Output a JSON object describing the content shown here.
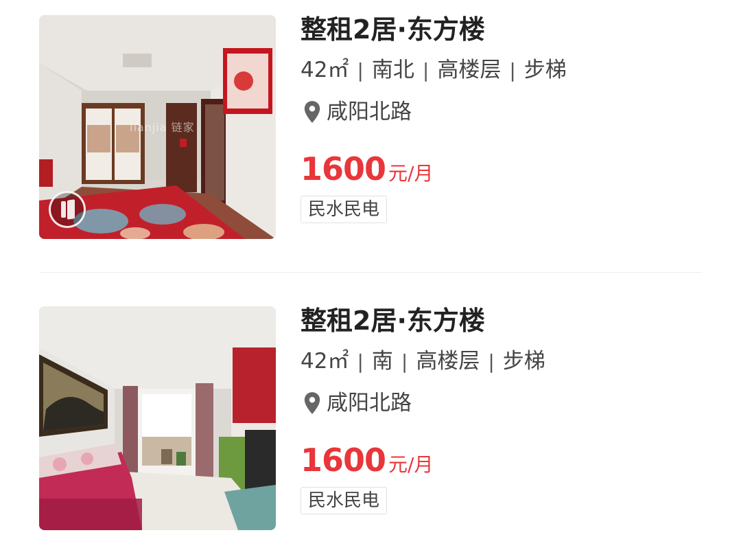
{
  "listings": [
    {
      "title": "整租2居·东方楼",
      "area": "42㎡",
      "orientation": "南北",
      "floor": "高楼层",
      "elevator": "步梯",
      "location": "咸阳北路",
      "price": "1600",
      "price_unit": "元/月",
      "tag": "民水民电",
      "thumb_watermark": "lianjia 链家",
      "has_vr_badge": true,
      "icon": "map-pin-icon"
    },
    {
      "title": "整租2居·东方楼",
      "area": "42㎡",
      "orientation": "南",
      "floor": "高楼层",
      "elevator": "步梯",
      "location": "咸阳北路",
      "price": "1600",
      "price_unit": "元/月",
      "tag": "民水民电",
      "has_vr_badge": false,
      "icon": "map-pin-icon"
    }
  ],
  "colors": {
    "price": "#e8363a",
    "title": "#222222",
    "meta": "#444444",
    "divider": "#eeeeee",
    "tag_border": "#e1e1e1"
  }
}
